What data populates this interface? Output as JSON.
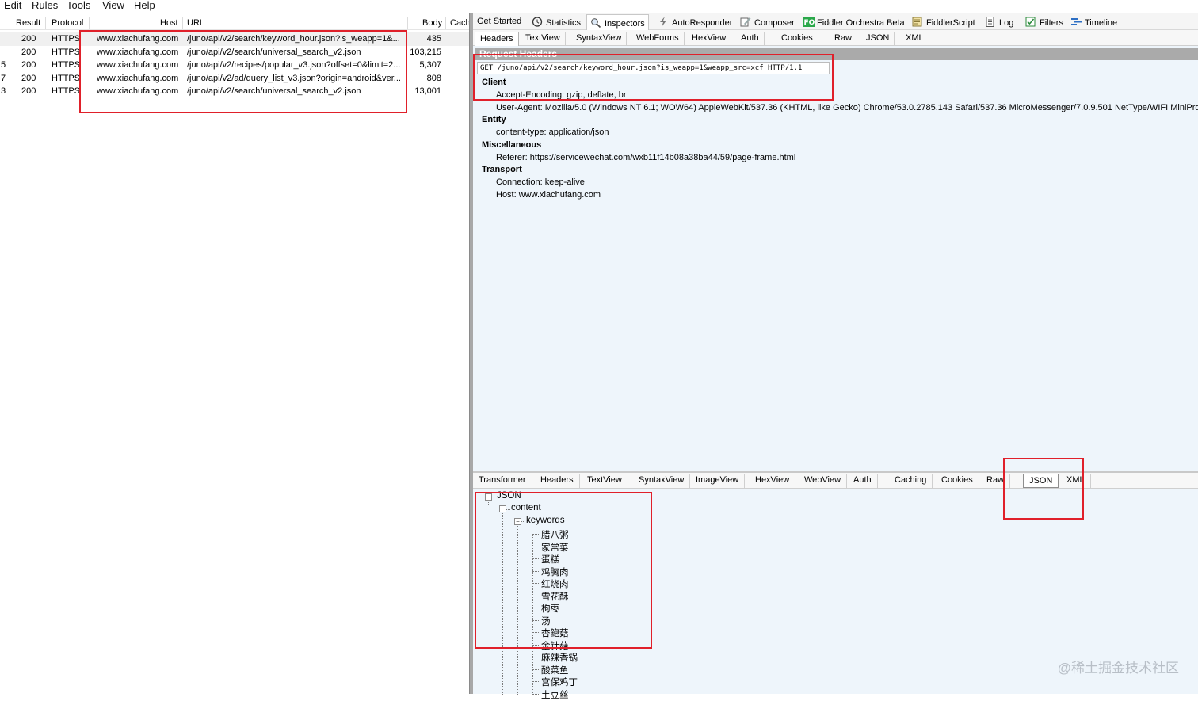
{
  "menu": [
    "Edit",
    "Rules",
    "Tools",
    "View",
    "Help"
  ],
  "sessions": {
    "columns": [
      "Result",
      "Protocol",
      "Host",
      "URL",
      "Body",
      "Cach"
    ],
    "rows": [
      {
        "num": "",
        "result": "200",
        "protocol": "HTTPS",
        "host": "www.xiachufang.com",
        "url": "/juno/api/v2/search/keyword_hour.json?is_weapp=1&...",
        "body": "435",
        "selected": true
      },
      {
        "num": "",
        "result": "200",
        "protocol": "HTTPS",
        "host": "www.xiachufang.com",
        "url": "/juno/api/v2/search/universal_search_v2.json",
        "body": "103,215",
        "selected": false
      },
      {
        "num": "5",
        "result": "200",
        "protocol": "HTTPS",
        "host": "www.xiachufang.com",
        "url": "/juno/api/v2/recipes/popular_v3.json?offset=0&limit=2...",
        "body": "5,307",
        "selected": false
      },
      {
        "num": "7",
        "result": "200",
        "protocol": "HTTPS",
        "host": "www.xiachufang.com",
        "url": "/juno/api/v2/ad/query_list_v3.json?origin=android&ver...",
        "body": "808",
        "selected": false
      },
      {
        "num": "3",
        "result": "200",
        "protocol": "HTTPS",
        "host": "www.xiachufang.com",
        "url": "/juno/api/v2/search/universal_search_v2.json",
        "body": "13,001",
        "selected": false
      }
    ]
  },
  "main_tabs": [
    {
      "label": "Get Started",
      "icon": ""
    },
    {
      "label": "Statistics",
      "icon": "clock-icon"
    },
    {
      "label": "Inspectors",
      "icon": "inspector-icon",
      "active": true
    },
    {
      "label": "AutoResponder",
      "icon": "lightning-icon"
    },
    {
      "label": "Composer",
      "icon": "composer-icon"
    },
    {
      "label": "Fiddler Orchestra Beta",
      "icon": "fo-icon"
    },
    {
      "label": "FiddlerScript",
      "icon": "script-icon"
    },
    {
      "label": "Log",
      "icon": "log-icon"
    },
    {
      "label": "Filters",
      "icon": "checkbox-icon"
    },
    {
      "label": "Timeline",
      "icon": "timeline-icon"
    }
  ],
  "request_tabs": [
    "Headers",
    "TextView",
    "SyntaxView",
    "WebForms",
    "HexView",
    "Auth",
    "Cookies",
    "Raw",
    "JSON",
    "XML"
  ],
  "request": {
    "title": "Request Headers",
    "line": "GET /juno/api/v2/search/keyword_hour.json?is_weapp=1&weapp_src=xcf HTTP/1.1",
    "groups": [
      {
        "name": "Client",
        "items": [
          "Accept-Encoding: gzip, deflate, br",
          "User-Agent: Mozilla/5.0 (Windows NT 6.1; WOW64) AppleWebKit/537.36 (KHTML, like Gecko) Chrome/53.0.2785.143 Safari/537.36 MicroMessenger/7.0.9.501 NetType/WIFI MiniProgramEnv"
        ]
      },
      {
        "name": "Entity",
        "items": [
          "content-type: application/json"
        ]
      },
      {
        "name": "Miscellaneous",
        "items": [
          "Referer: https://servicewechat.com/wxb11f14b08a38ba44/59/page-frame.html"
        ]
      },
      {
        "name": "Transport",
        "items": [
          "Connection: keep-alive",
          "Host: www.xiachufang.com"
        ]
      }
    ]
  },
  "response_tabs": [
    "Transformer",
    "Headers",
    "TextView",
    "SyntaxView",
    "ImageView",
    "HexView",
    "WebView",
    "Auth",
    "Caching",
    "Cookies",
    "Raw",
    "JSON",
    "XML"
  ],
  "response_active": "JSON",
  "json_tree": {
    "root": "JSON",
    "content": "content",
    "keywords_label": "keywords",
    "keywords": [
      "腊八粥",
      "家常菜",
      "蛋糕",
      "鸡胸肉",
      "红烧肉",
      "雪花酥",
      "枸枣",
      "汤",
      "杏鲍菇",
      "金针菇",
      "麻辣香锅",
      "酸菜鱼",
      "宫保鸡丁",
      "土豆丝"
    ]
  },
  "watermark": "@稀土掘金技术社区",
  "colors": {
    "highlight": "#e0202a",
    "pane": "#eef5fb",
    "header_bar": "#aaaaaa"
  }
}
